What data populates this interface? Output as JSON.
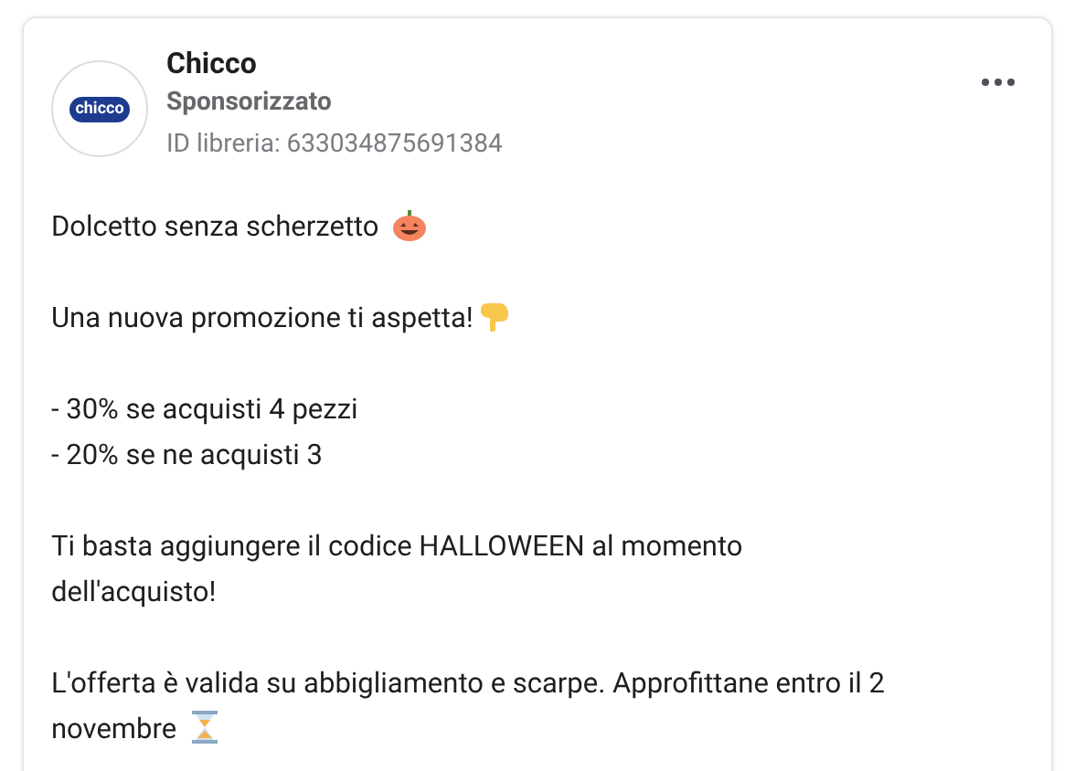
{
  "post": {
    "logo_text": "chicco",
    "name": "Chicco",
    "label": "Sponsorizzato",
    "library_id": "ID libreria: 633034875691384",
    "paragraphs": [
      {
        "lines": [
          "Dolcetto senza scherzetto"
        ]
      },
      {
        "lines": [
          "Una nuova promozione ti aspetta!"
        ]
      },
      {
        "lines": [
          "- 30% se acquisti 4 pezzi",
          "- 20% se ne acquisti 3"
        ]
      },
      {
        "lines": [
          "Ti basta aggiungere il codice HALLOWEEN al momento",
          "dell'acquisto!"
        ]
      },
      {
        "lines": [
          "L'offerta è valida su abbigliamento e scarpe. Approfittane entro il 2",
          "novembre"
        ]
      }
    ]
  }
}
